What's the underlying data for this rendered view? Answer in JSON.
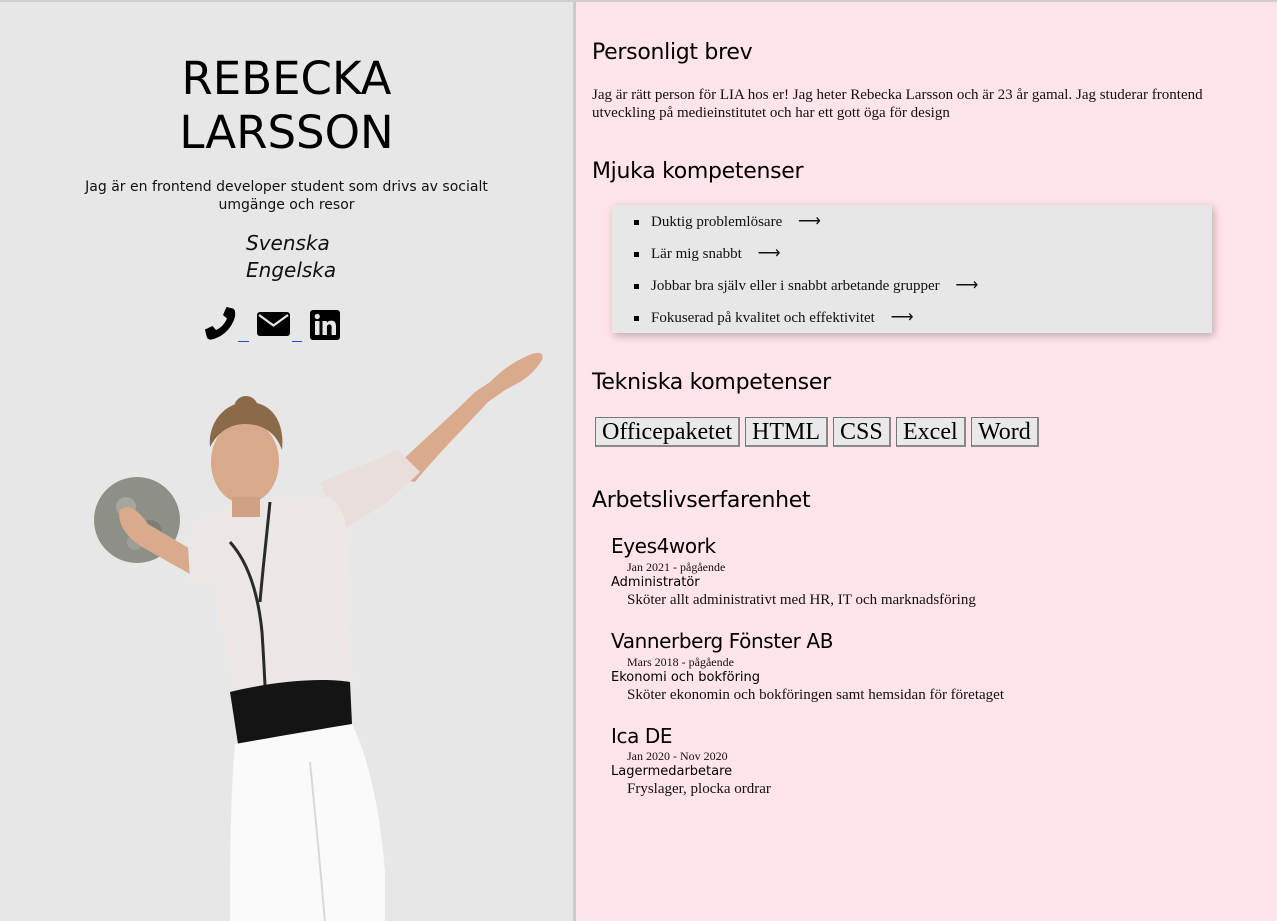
{
  "profile": {
    "first_name": "REBECKA",
    "last_name": "LARSSON",
    "tagline": "Jag är en frontend developer student som drivs av socialt umgänge och resor",
    "languages": [
      "Svenska",
      "Engelska"
    ],
    "contacts": {
      "phone_icon": "phone-icon",
      "email_icon": "envelope-icon",
      "linkedin_icon": "linkedin-icon"
    }
  },
  "letter": {
    "heading": "Personligt brev",
    "text": "Jag är rätt person för LIA hos er! Jag heter Rebecka Larsson och är 23 år gamal. Jag studerar frontend utveckling på medieinstitutet och har ett gott öga för design"
  },
  "soft_skills": {
    "heading": "Mjuka kompetenser",
    "arrow": "⟶",
    "items": [
      "Duktig problemlösare",
      "Lär mig snabbt",
      "Jobbar bra själv eller i snabbt arbetande grupper",
      "Fokuserad på kvalitet och effektivitet"
    ]
  },
  "tech_skills": {
    "heading": "Tekniska kompetenser",
    "items": [
      "Officepaketet",
      "HTML",
      "CSS",
      "Excel",
      "Word"
    ]
  },
  "experience": {
    "heading": "Arbetslivserfarenhet",
    "jobs": [
      {
        "company": "Eyes4work",
        "period": "Jan 2021 - pågående",
        "role": "Administratör",
        "description": "Sköter allt administrativt med HR, IT och marknadsföring"
      },
      {
        "company": "Vannerberg Fönster AB",
        "period": "Mars 2018 - pågående",
        "role": "Ekonomi och bokföring",
        "description": "Sköter ekonomin och bokföringen samt hemsidan för företaget"
      },
      {
        "company": "Ica DE",
        "period": "Jan 2020 - Nov 2020",
        "role": "Lagermedarbetare",
        "description": "Fryslager, plocka ordrar"
      }
    ]
  },
  "colors": {
    "left_bg": "#e7e7e7",
    "right_bg": "#ffe4e9",
    "link_underline": "#1a4fd6"
  }
}
